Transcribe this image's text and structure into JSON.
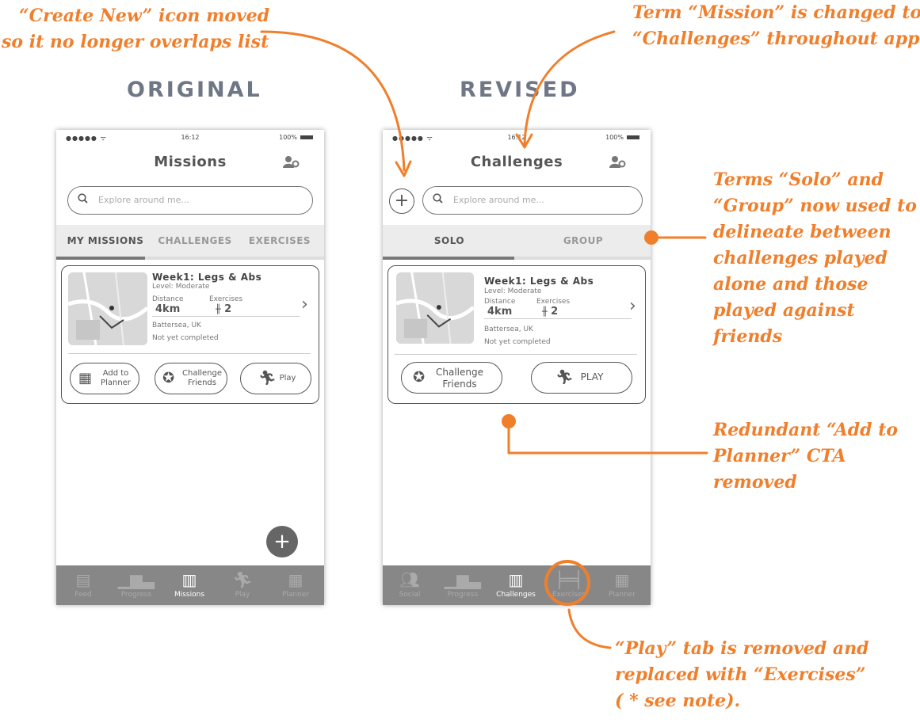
{
  "headings": {
    "original": "ORIGINAL",
    "revised": "REVISED"
  },
  "annotations": {
    "create_new": [
      "“Create New” icon moved",
      "so it no longer overlaps list"
    ],
    "term_mission": [
      "Term “Mission” is changed to",
      "“Challenges” throughout app"
    ],
    "solo_group": [
      "Terms “Solo” and",
      "“Group” now used to",
      "delineate between",
      "challenges played",
      "alone and those",
      "played against",
      "friends"
    ],
    "redundant": [
      "Redundant “Add to",
      "Planner” CTA",
      "removed"
    ],
    "play_tab": [
      "“Play” tab is removed and",
      "replaced with “Exercises”",
      "( * see note)."
    ]
  },
  "colors": {
    "accent": "#f07f2c",
    "heading": "#6f7786",
    "nav_bg": "#878787"
  },
  "original": {
    "status": {
      "signal": "●●●●● ᯤ",
      "time": "16:12",
      "battery": "100%"
    },
    "title": "Missions",
    "search_placeholder": "Explore around me...",
    "tabs": [
      "MY MISSIONS",
      "CHALLENGES",
      "EXERCISES"
    ],
    "card": {
      "title": "Week1: Legs & Abs",
      "level": "Level: Moderate",
      "distance_label": "Distance",
      "distance_value": "4km",
      "exercises_label": "Exercises",
      "exercises_value": "2",
      "location": "Battersea, UK",
      "status": "Not yet completed",
      "buttons": {
        "planner": "Add to Planner",
        "challenge": "Challenge Friends",
        "play": "Play"
      }
    },
    "fab": "+",
    "nav": [
      "Feed",
      "Progress",
      "Missions",
      "Play",
      "Planner"
    ]
  },
  "revised": {
    "status": {
      "signal": "●●●●● ᯤ",
      "time": "16:12",
      "battery": "100%"
    },
    "title": "Challenges",
    "search_placeholder": "Explore around me...",
    "create_icon": "+",
    "tabs": [
      "SOLO",
      "GROUP"
    ],
    "card": {
      "title": "Week1: Legs & Abs",
      "level": "Level: Moderate",
      "distance_label": "Distance",
      "distance_value": "4km",
      "exercises_label": "Exercises",
      "exercises_value": "2",
      "location": "Battersea, UK",
      "status": "Not yet completed",
      "buttons": {
        "challenge": "Challenge Friends",
        "play": "PLAY"
      }
    },
    "nav": [
      "Social",
      "Progress",
      "Challenges",
      "Exercises",
      "Planner"
    ]
  }
}
